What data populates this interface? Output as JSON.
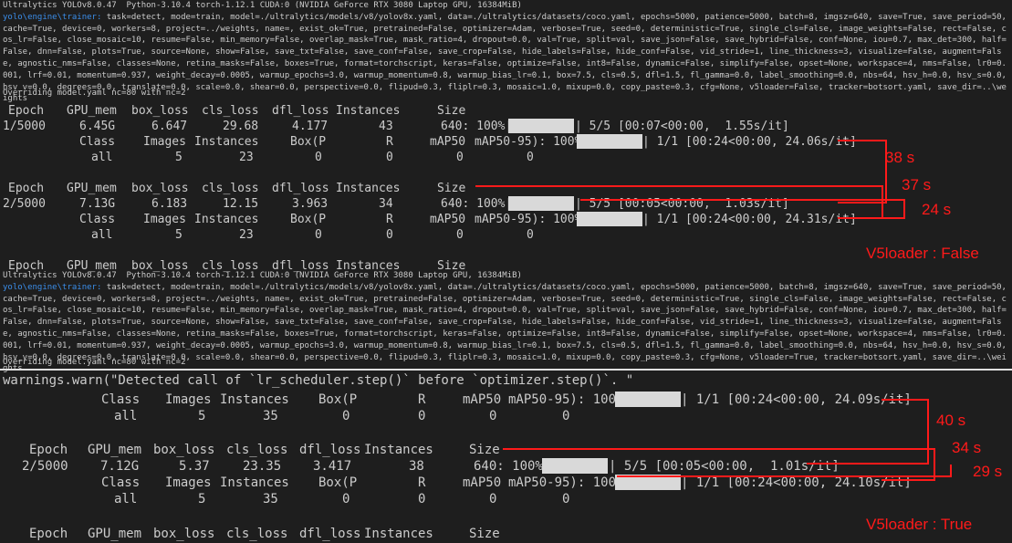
{
  "block1": {
    "version_line": "Ultralytics YOLOv8.0.47  Python-3.10.4 torch-1.12.1 CUDA:0 (NVIDIA GeForce RTX 3080 Laptop GPU, 16384MiB)",
    "prompt": "yolo\\engine\\trainer:",
    "args": " task=detect, mode=train, model=./ultralytics/models/v8/yolov8x.yaml, data=./ultralytics/datasets/coco.yaml, epochs=5000, patience=5000, batch=8, imgsz=640, save=True, save_period=50, cache=True, device=0, workers=8, project=../weights, name=, exist_ok=True, pretrained=False, optimizer=Adam, verbose=True, seed=0, deterministic=True, single_cls=False, image_weights=False, rect=False, cos_lr=False, close_mosaic=10, resume=False, min_memory=False, overlap_mask=True, mask_ratio=4, dropout=0.0, val=True, split=val, save_json=False, save_hybrid=False, conf=None, iou=0.7, max_det=300, half=False, dnn=False, plots=True, source=None, show=False, save_txt=False, save_conf=False, save_crop=False, hide_labels=False, hide_conf=False, vid_stride=1, line_thickness=3, visualize=False, augment=False, agnostic_nms=False, classes=None, retina_masks=False, boxes=True, format=torchscript, keras=False, optimize=False, int8=False, dynamic=False, simplify=False, opset=None, workspace=4, nms=False, lr0=0.001, lrf=0.01, momentum=0.937, weight_decay=0.0005, warmup_epochs=3.0, warmup_momentum=0.8, warmup_bias_lr=0.1, box=7.5, cls=0.5, dfl=1.5, fl_gamma=0.0, label_smoothing=0.0, nbs=64, hsv_h=0.0, hsv_s=0.0, hsv_v=0.0, degrees=0.0, translate=0.0, scale=0.0, shear=0.0, perspective=0.0, flipud=0.3, fliplr=0.3, mosaic=1.0, mixup=0.0, copy_paste=0.3, cfg=None, v5loader=False, tracker=botsort.yaml, save_dir=..\\weights",
    "override": "Overriding model.yaml nc=80 with nc=2"
  },
  "block2": {
    "version_line": "Ultralytics YOLOv8.0.47  Python-3.10.4 torch-1.12.1 CUDA:0 (NVIDIA GeForce RTX 3080 Laptop GPU, 16384MiB)",
    "prompt": "yolo\\engine\\trainer:",
    "args": " task=detect, mode=train, model=./ultralytics/models/v8/yolov8x.yaml, data=./ultralytics/datasets/coco.yaml, epochs=5000, patience=5000, batch=8, imgsz=640, save=True, save_period=50, cache=True, device=0, workers=8, project=../weights, name=, exist_ok=True, pretrained=False, optimizer=Adam, verbose=True, seed=0, deterministic=True, single_cls=False, image_weights=False, rect=False, cos_lr=False, close_mosaic=10, resume=False, min_memory=False, overlap_mask=True, mask_ratio=4, dropout=0.0, val=True, split=val, save_json=False, save_hybrid=False, conf=None, iou=0.7, max_det=300, half=False, dnn=False, plots=True, source=None, show=False, save_txt=False, save_conf=False, save_crop=False, hide_labels=False, hide_conf=False, vid_stride=1, line_thickness=3, visualize=False, augment=False, agnostic_nms=False, classes=None, retina_masks=False, boxes=True, format=torchscript, keras=False, optimize=False, int8=False, dynamic=False, simplify=False, opset=None, workspace=4, nms=False, lr0=0.001, lrf=0.01, momentum=0.937, weight_decay=0.0005, warmup_epochs=3.0, warmup_momentum=0.8, warmup_bias_lr=0.1, box=7.5, cls=0.5, dfl=1.5, fl_gamma=0.0, label_smoothing=0.0, nbs=64, hsv_h=0.0, hsv_s=0.0, hsv_v=0.0, degrees=0.0, translate=0.0, scale=0.0, shear=0.0, perspective=0.0, flipud=0.3, fliplr=0.3, mosaic=1.0, mixup=0.0, copy_paste=0.3, cfg=None, v5loader=True, tracker=botsort.yaml, save_dir=..\\weights",
    "override": "Overriding model.yaml nc=80 with nc=2"
  },
  "train_headers": [
    "Epoch",
    "GPU_mem",
    "box_loss",
    "cls_loss",
    "dfl_loss",
    "Instances",
    "Size"
  ],
  "val_headers": [
    "Class",
    "Images",
    "Instances",
    "Box(P",
    "R",
    "mAP50",
    "mAP50-95): 100%|"
  ],
  "top": {
    "epoch1": {
      "values": [
        "1/5000",
        "6.45G",
        "6.647",
        "29.68",
        "4.177",
        "43",
        "640: 100%|"
      ],
      "progress_tail": "| 5/5 [00:07<00:00,  1.55s/it]",
      "progress_fraction": 1.0,
      "val_tail": "| 1/1 [00:24<00:00, 24.06s/it]",
      "all_row": [
        "all",
        "5",
        "23",
        "0",
        "0",
        "0",
        "0"
      ]
    },
    "epoch2": {
      "values": [
        "2/5000",
        "7.13G",
        "6.183",
        "12.15",
        "3.963",
        "34",
        "640: 100%|"
      ],
      "progress_tail": "| 5/5 [00:05<00:00,  1.03s/it]",
      "progress_fraction": 1.0,
      "val_tail": "| 1/1 [00:24<00:00, 24.31s/it]",
      "all_row": [
        "all",
        "5",
        "23",
        "0",
        "0",
        "0",
        "0"
      ]
    },
    "next_header_row": [
      "Epoch",
      "GPU_mem",
      "box_loss",
      "cls_loss",
      "dfl_loss",
      "Instances",
      "Size"
    ]
  },
  "bottom": {
    "warning": "warnings.warn(\"Detected call of `lr_scheduler.step()` before `optimizer.step()`. \"",
    "val1_tail": "| 1/1 [00:24<00:00, 24.09s/it]",
    "all1": [
      "all",
      "5",
      "35",
      "0",
      "0",
      "0",
      "0"
    ],
    "epoch2": {
      "values": [
        "2/5000",
        "7.12G",
        "5.37",
        "23.35",
        "3.417",
        "38",
        "640: 100%|"
      ],
      "progress_tail": "| 5/5 [00:05<00:00,  1.01s/it]"
    },
    "val2_tail": "| 1/1 [00:24<00:00, 24.10s/it]",
    "all2": [
      "all",
      "5",
      "35",
      "0",
      "0",
      "0",
      "0"
    ]
  },
  "annotations": {
    "top": {
      "t1": "38 s",
      "t2": "37 s",
      "t3": "24 s",
      "label": "V5loader : False"
    },
    "bottom": {
      "t1": "40 s",
      "t2": "34 s",
      "t3": "29 s",
      "label": "V5loader : True"
    },
    "color": "#ff1a1a"
  },
  "colors": {
    "background": "#1e1e1e",
    "text": "#cccccc",
    "prompt": "#3b8eea",
    "bar": "#d9d9d9"
  }
}
